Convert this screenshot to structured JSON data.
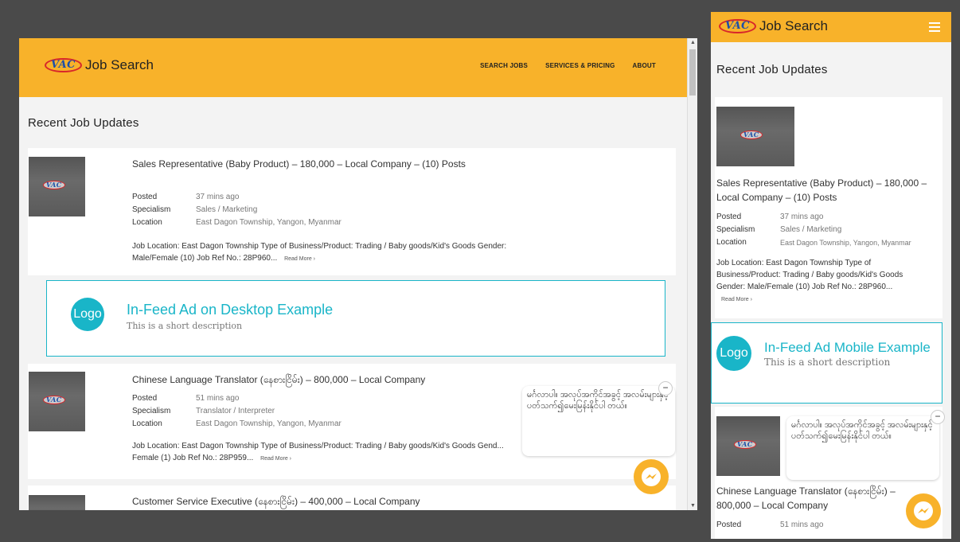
{
  "brand": {
    "logo_text": "VAC",
    "name": "Job Search"
  },
  "nav": [
    "SEARCH JOBS",
    "SERVICES & PRICING",
    "ABOUT"
  ],
  "section_title": "Recent Job Updates",
  "jobs": [
    {
      "title": "Sales Representative (Baby Product) – 180,000 – Local Company – (10) Posts",
      "posted_label": "Posted",
      "posted": "37 mins ago",
      "specialism_label": "Specialism",
      "specialism": "Sales / Marketing",
      "location_label": "Location",
      "location": "East Dagon Township, Yangon, Myanmar",
      "description": "Job Location: East Dagon Township Type of Business/Product: Trading / Baby goods/Kid's Goods Gender: Male/Female (10) Job Ref No.: 28P960...",
      "read_more": "Read More ›"
    },
    {
      "title": "Chinese Language Translator (နေစားငြိမ်း) – 800,000 – Local Company",
      "posted_label": "Posted",
      "posted": "51 mins ago",
      "specialism_label": "Specialism",
      "specialism": "Translator / Interpreter",
      "location_label": "Location",
      "location": "East Dagon Township, Yangon, Myanmar",
      "description": "Job Location: East Dagon Township Type of Business/Product: Trading / Baby goods/Kid's Goods Gend... Female (1) Job Ref No.: 28P959...",
      "read_more": "Read More ›"
    },
    {
      "title": "Customer Service Executive (နေစားငြိမ်း) – 400,000 – Local Company"
    }
  ],
  "ad_desktop": {
    "logo": "Logo",
    "title": "In-Feed Ad on Desktop Example",
    "description": "This is a short description"
  },
  "ad_mobile": {
    "logo": "Logo",
    "title": "In-Feed Ad Mobile Example",
    "description": "This is a short description"
  },
  "chat": {
    "message": "မင်္ဂလာပါ။ အလုပ်အကိုင်အခွင့် အလမ်းများနှင့် ပတ်သက်၍မေးမြန်းနိုင်ပါ တယ်။",
    "close": "−"
  },
  "colors": {
    "header": "#f8b22a",
    "ad_accent": "#19b5c8",
    "background": "#4a4a4a"
  }
}
